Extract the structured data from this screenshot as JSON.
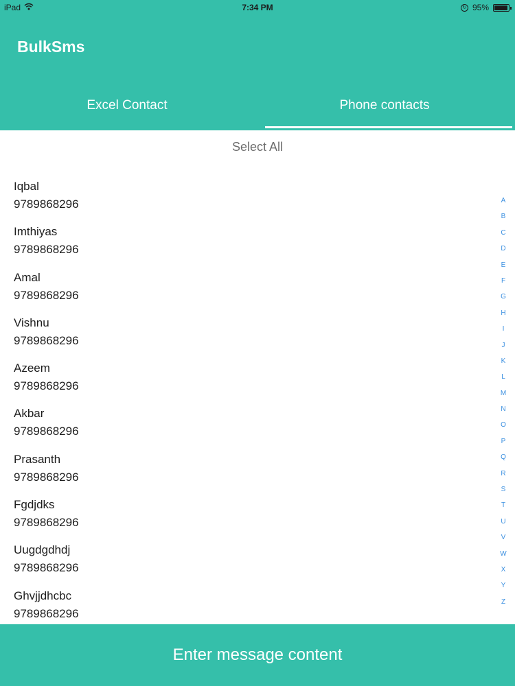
{
  "status_bar": {
    "device": "iPad",
    "time": "7:34 PM",
    "battery": "95%",
    "battery_level": 0.95
  },
  "header": {
    "title": "BulkSms",
    "tabs": [
      {
        "label": "Excel Contact",
        "selected": false
      },
      {
        "label": "Phone contacts",
        "selected": true
      }
    ]
  },
  "select_all_label": "Select All",
  "contacts": [
    {
      "name": "Iqbal",
      "phone": "9789868296"
    },
    {
      "name": "Imthiyas",
      "phone": "9789868296"
    },
    {
      "name": "Amal",
      "phone": "9789868296"
    },
    {
      "name": "Vishnu",
      "phone": "9789868296"
    },
    {
      "name": "Azeem",
      "phone": "9789868296"
    },
    {
      "name": "Akbar",
      "phone": "9789868296"
    },
    {
      "name": "Prasanth",
      "phone": "9789868296"
    },
    {
      "name": "Fgdjdks",
      "phone": "9789868296"
    },
    {
      "name": "Uugdgdhdj",
      "phone": "9789868296"
    },
    {
      "name": "Ghvjjdhcbc",
      "phone": "9789868296"
    }
  ],
  "index_letters": [
    "A",
    "B",
    "C",
    "D",
    "E",
    "F",
    "G",
    "H",
    "I",
    "J",
    "K",
    "L",
    "M",
    "N",
    "O",
    "P",
    "Q",
    "R",
    "S",
    "T",
    "U",
    "V",
    "W",
    "X",
    "Y",
    "Z"
  ],
  "bottom_button_label": "Enter message content",
  "colors": {
    "accent": "#35bfaa",
    "index_letter": "#3a8fe0",
    "select_all": "#6d6d6d"
  },
  "icons": [
    "wifi-icon",
    "location-lock-icon",
    "battery-icon"
  ]
}
